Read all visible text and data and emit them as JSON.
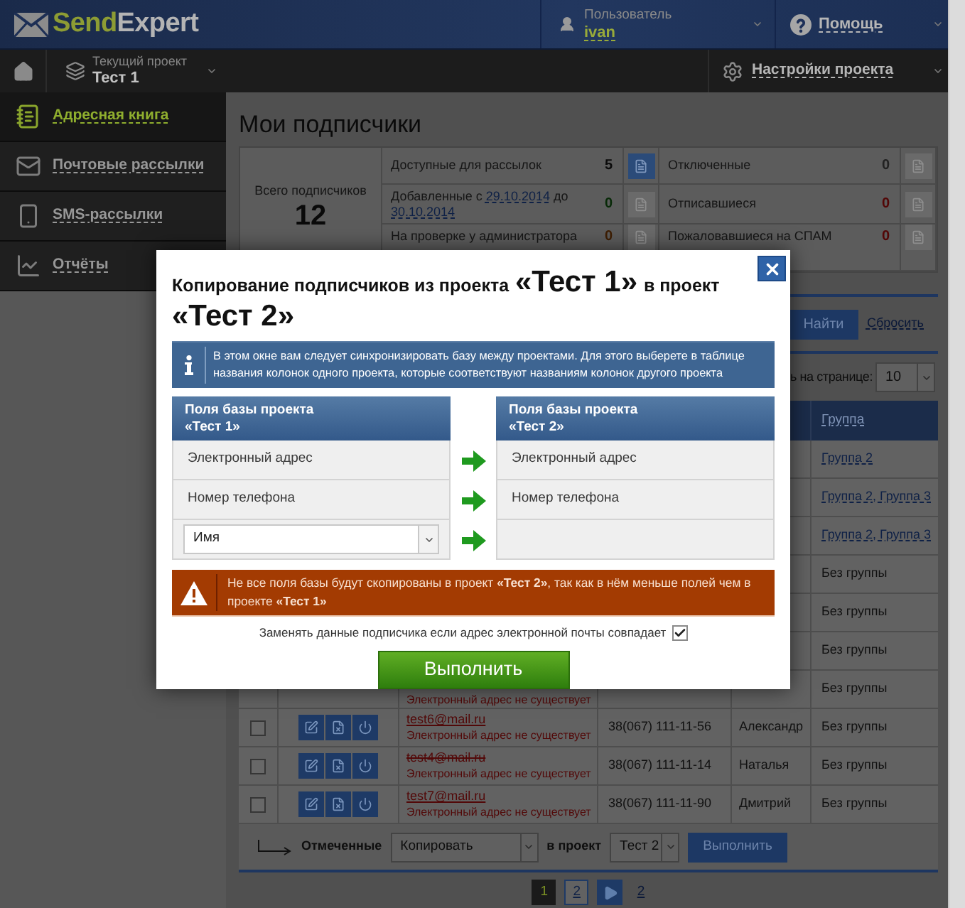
{
  "header": {
    "logo": [
      "Send",
      "Expert"
    ],
    "user_label": "Пользователь",
    "user_name": "ivan",
    "help": "Помощь"
  },
  "project_bar": {
    "label": "Текущий проект",
    "project": "Тест 1",
    "settings": "Настройки проекта"
  },
  "sidebar": {
    "items": [
      {
        "label": "Адресная книга",
        "selected": true
      },
      {
        "label": "Почтовые рассылки",
        "selected": false
      },
      {
        "label": "SMS-рассылки",
        "selected": false
      },
      {
        "label": "Отчёты",
        "selected": false
      }
    ]
  },
  "page_title": "Мои подписчики",
  "stats": {
    "total_label": "Всего подписчиков",
    "total_value": "12",
    "items": [
      {
        "kind": "plain",
        "label": "Доступные для рассылок",
        "value": "5",
        "color": "#0b0b0b",
        "active": true
      },
      {
        "kind": "plain",
        "label": "Отключенные",
        "value": "0",
        "color": "#222222",
        "active": false
      },
      {
        "kind": "date_range",
        "label": "Добавленные с",
        "from": "29.10.2014",
        "joiner": "до",
        "to": "30.10.2014",
        "value": "0",
        "color": "#082a08",
        "active": false
      },
      {
        "kind": "plain",
        "label": "Отписавшиеся",
        "value": "0",
        "color": "#520606",
        "active": false
      },
      {
        "kind": "plain",
        "label": "На проверке у администратора",
        "value": "0",
        "color": "#3e1e03",
        "active": false
      },
      {
        "kind": "plain",
        "label": "Пожаловавшиеся на СПАМ",
        "value": "0",
        "color": "#520606",
        "active": false
      }
    ]
  },
  "filter": {
    "find": "Найти",
    "reset": "Сбросить"
  },
  "per_page": {
    "label": "ь на странице:",
    "value": "10"
  },
  "table": {
    "group_heading": "Группа",
    "rows": [
      {
        "group": "Группа 2",
        "group_link": true
      },
      {
        "group": "Группа 2, Группа 3",
        "group_link": true
      },
      {
        "group": "Группа 2, Группа 3",
        "group_link": true
      },
      {
        "group": "Без группы",
        "group_link": false
      },
      {
        "group": "Без группы",
        "group_link": false
      },
      {
        "group": "Без группы",
        "group_link": false
      },
      {
        "status": "Электронный адрес не существует",
        "group": "Без группы",
        "group_link": false
      },
      {
        "checked": false,
        "email": "test6@mail.ru",
        "struck": false,
        "status": "Электронный адрес не существует",
        "phone": "38(067) 111-11-56",
        "name": "Александр",
        "group": "Без группы",
        "group_link": false
      },
      {
        "checked": false,
        "email": "test4@mail.ru",
        "struck": true,
        "status": "Электронный адрес не существует",
        "phone": "38(067) 111-11-14",
        "name": "Наталья",
        "group": "Без группы",
        "group_link": false
      },
      {
        "checked": false,
        "email": "test7@mail.ru",
        "struck": false,
        "status": "Электронный адрес не существует",
        "phone": "38(067) 111-11-90",
        "name": "Дмитрий",
        "group": "Без группы",
        "group_link": false
      }
    ],
    "footer": {
      "selected_label": "Отмеченные",
      "action": "Копировать",
      "to_label": "в проект",
      "project": "Тест 2",
      "button": "Выполнить"
    }
  },
  "pagination": {
    "pages": [
      {
        "label": "1",
        "selected": true
      },
      {
        "label": "2",
        "selected": false
      }
    ],
    "last": "2"
  },
  "dialog": {
    "title": [
      {
        "text": "Копирование подписчиков из проекта",
        "emphasis": false
      },
      {
        "text": "«Тест 1»",
        "emphasis": true
      },
      {
        "text": "в проект",
        "emphasis": false
      },
      {
        "text": "«Тест 2»",
        "emphasis": true
      }
    ],
    "info": "В этом окне вам следует синхронизировать базу между проектами. Для этого выберете в таблице названия колонок одного проекта, которые соответствуют названиям колонок другого проекта",
    "source": {
      "heading": "Поля базы проекта",
      "project": "«Тест 1»"
    },
    "target": {
      "heading": "Поля базы проекта",
      "project": "«Тест 2»"
    },
    "mapping": [
      {
        "source": {
          "kind": "text",
          "value": "Электронный адрес"
        },
        "target": "Электронный адрес"
      },
      {
        "source": {
          "kind": "text",
          "value": "Номер телефона"
        },
        "target": "Номер телефона"
      },
      {
        "source": {
          "kind": "select",
          "value": "Имя"
        }
      }
    ],
    "warning": "Не все поля базы будут скопированы в проект **«Тест 2»**, так как в нём меньше полей чем в проекте **«Тест 1»**",
    "replace": {
      "label": "Заменять данные подписчика если адрес электронной почты совпадает",
      "checked": true
    },
    "submit": "Выполнить"
  }
}
